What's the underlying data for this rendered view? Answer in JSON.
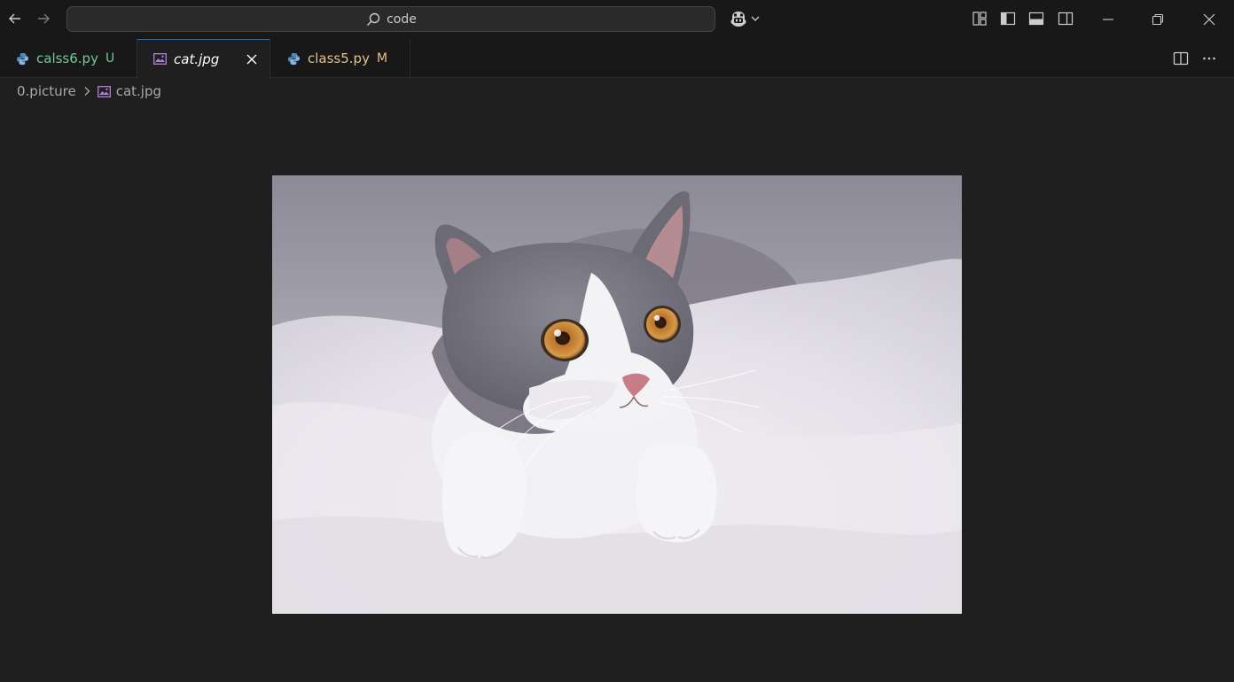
{
  "window": {
    "search_text": "code"
  },
  "tabs": [
    {
      "label": "calss6.py",
      "status": "U",
      "kind": "python",
      "label_color": "#73c991",
      "status_color": "#73c991"
    },
    {
      "label": "cat.jpg",
      "status": "",
      "kind": "image",
      "label_color": "#ffffff",
      "active": true
    },
    {
      "label": "class5.py",
      "status": "M",
      "kind": "python",
      "label_color": "#e2c08d",
      "status_color": "#e2c08d"
    }
  ],
  "breadcrumb": {
    "folder": "0.picture",
    "file": "cat.jpg"
  },
  "icons": {
    "back": "arrow-left-icon",
    "forward": "arrow-right-icon",
    "search": "search-icon",
    "copilot": "copilot-icon",
    "layout_customize": "customize-layout-icon",
    "toggle_primary_sidebar": "sidebar-left-icon",
    "toggle_panel": "panel-bottom-icon",
    "toggle_secondary_sidebar": "sidebar-right-icon",
    "minimize": "minimize-icon",
    "restore": "restore-icon",
    "close": "close-icon",
    "split_editor": "split-editor-icon",
    "more_actions": "more-icon"
  },
  "colors": {
    "accent": "#0078d4",
    "editor_bg": "#1f1f1f",
    "chrome_bg": "#181818"
  }
}
